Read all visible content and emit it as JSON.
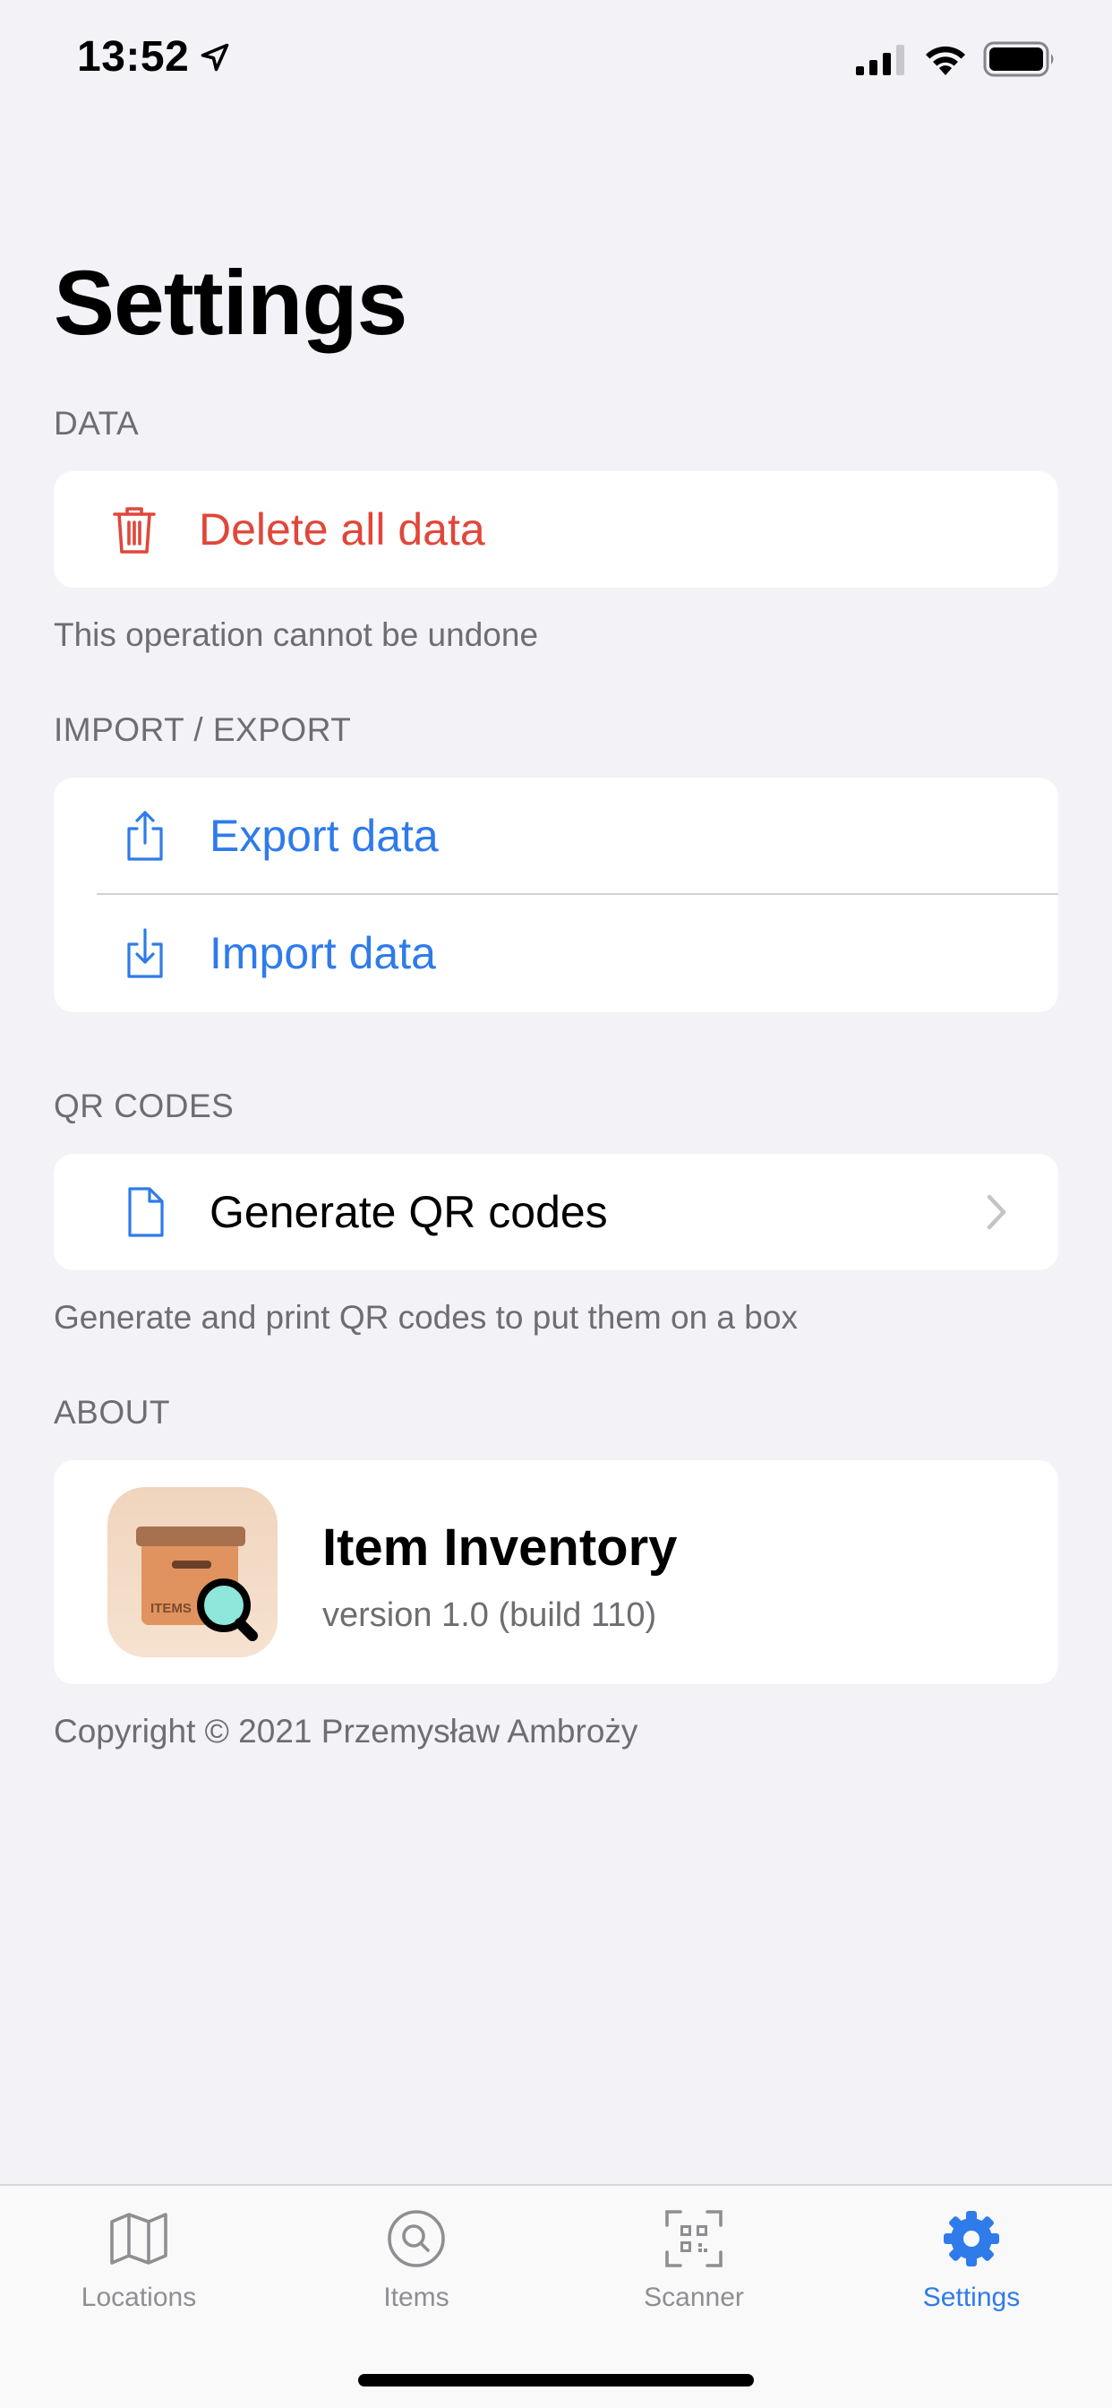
{
  "status_bar": {
    "time": "13:52"
  },
  "title": "Settings",
  "sections": {
    "data": {
      "header": "DATA",
      "delete_label": "Delete all data",
      "footer": "This operation cannot be undone"
    },
    "import_export": {
      "header": "IMPORT / EXPORT",
      "export_label": "Export data",
      "import_label": "Import data"
    },
    "qr_codes": {
      "header": "QR CODES",
      "generate_label": "Generate QR codes",
      "footer": "Generate and print QR codes to put them on a box"
    },
    "about": {
      "header": "ABOUT",
      "app_name": "Item Inventory",
      "version": "version 1.0 (build 110)",
      "app_icon_text": "ITEMS",
      "footer": "Copyright © 2021 Przemysław Ambroży"
    }
  },
  "tabs": [
    {
      "label": "Locations",
      "icon": "map-icon",
      "active": false
    },
    {
      "label": "Items",
      "icon": "magnifier-icon",
      "active": false
    },
    {
      "label": "Scanner",
      "icon": "qr-scan-icon",
      "active": false
    },
    {
      "label": "Settings",
      "icon": "gear-icon",
      "active": true
    }
  ],
  "colors": {
    "accent": "#2F7BEA",
    "destructive": "#E0473A",
    "background": "#F2F2F7",
    "secondary_text": "#6D6D72"
  }
}
